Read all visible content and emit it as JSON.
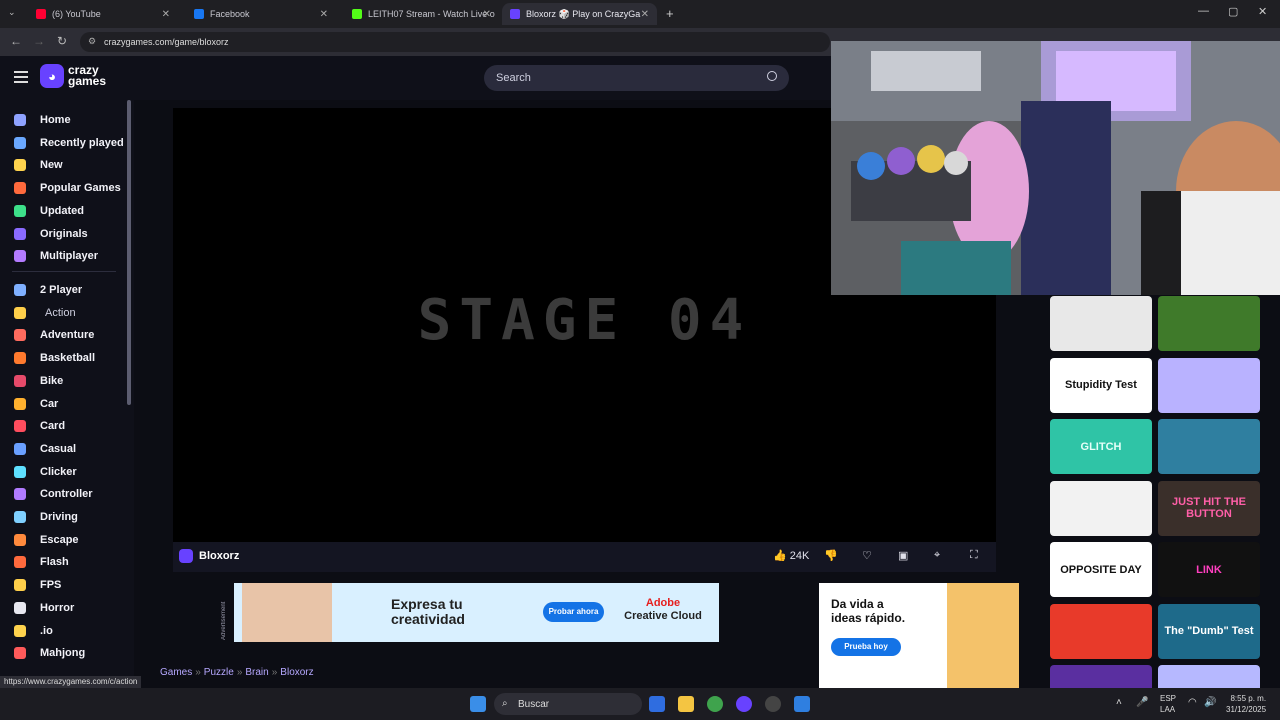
{
  "browser": {
    "tabs": [
      {
        "label": "(6) YouTube",
        "color": "#ff0033",
        "active": false
      },
      {
        "label": "Facebook",
        "color": "#1877f2",
        "active": false
      },
      {
        "label": "LEITH07 Stream - Watch Live o",
        "color": "#53fc18",
        "active": false
      },
      {
        "label": "Bloxorz 🎲 Play on CrazyGa",
        "color": "#6842ff",
        "active": true
      }
    ],
    "url": "crazygames.com/game/bloxorz",
    "status_url": "https://www.crazygames.com/c/action"
  },
  "site": {
    "logo_line1": "crazy",
    "logo_line2": "games",
    "search_placeholder": "Search"
  },
  "sidebar": {
    "top_items": [
      {
        "label": "Home",
        "icon": "home-icon",
        "color": "#8ea2ff"
      },
      {
        "label": "Recently played",
        "icon": "clock-icon",
        "color": "#6aa8ff"
      },
      {
        "label": "New",
        "icon": "sparkle-icon",
        "color": "#ffd34d"
      },
      {
        "label": "Popular Games",
        "icon": "fire-icon",
        "color": "#ff6a3d"
      },
      {
        "label": "Updated",
        "icon": "refresh-icon",
        "color": "#3de08a"
      },
      {
        "label": "Originals",
        "icon": "crazygames-icon",
        "color": "#8a6bff"
      },
      {
        "label": "Multiplayer",
        "icon": "players-icon",
        "color": "#b47bff"
      }
    ],
    "categories": [
      {
        "label": "2 Player",
        "icon": "two-player-icon",
        "color": "#7fb0ff"
      },
      {
        "label": "Action",
        "icon": "sword-icon",
        "color": "#ffcf4a"
      },
      {
        "label": "Adventure",
        "icon": "compass-icon",
        "color": "#ff6b5e"
      },
      {
        "label": "Basketball",
        "icon": "basketball-icon",
        "color": "#ff7a2e"
      },
      {
        "label": "Bike",
        "icon": "bike-icon",
        "color": "#e64a6a"
      },
      {
        "label": "Car",
        "icon": "car-icon",
        "color": "#ffb02e"
      },
      {
        "label": "Card",
        "icon": "card-icon",
        "color": "#ff4d5e"
      },
      {
        "label": "Casual",
        "icon": "casual-icon",
        "color": "#6aa0ff"
      },
      {
        "label": "Clicker",
        "icon": "cursor-icon",
        "color": "#5ee0ff"
      },
      {
        "label": "Controller",
        "icon": "gamepad-icon",
        "color": "#b07bff"
      },
      {
        "label": "Driving",
        "icon": "steering-icon",
        "color": "#7fd0ff"
      },
      {
        "label": "Escape",
        "icon": "door-icon",
        "color": "#ff8a3d"
      },
      {
        "label": "Flash",
        "icon": "flash-icon",
        "color": "#ff6a3d"
      },
      {
        "label": "FPS",
        "icon": "gun-icon",
        "color": "#ffcf4a"
      },
      {
        "label": "Horror",
        "icon": "ghost-icon",
        "color": "#e8e8f0"
      },
      {
        "label": ".io",
        "icon": "io-icon",
        "color": "#ffd34d"
      },
      {
        "label": "Mahjong",
        "icon": "mahjong-icon",
        "color": "#ff5a5a"
      }
    ]
  },
  "game": {
    "stage_text": "STAGE 04",
    "name": "Bloxorz",
    "likes": "24K"
  },
  "ads": {
    "ad1_label": "Advertisement",
    "ad1_headline_1": "Expresa tu",
    "ad1_headline_2": "creatividad",
    "ad1_cta": "Probar ahora",
    "ad1_brand_1": "Adobe",
    "ad1_brand_2": "Creative Cloud",
    "ad2_headline_1": "Da vida a",
    "ad2_headline_2": "ideas rápido.",
    "ad2_cta": "Prueba hoy"
  },
  "breadcrumb": [
    "Games",
    "Puzzle",
    "Brain",
    "Bloxorz"
  ],
  "thumbnails": [
    {
      "label": "",
      "bg": "#e8e8e8",
      "fg": "#111"
    },
    {
      "label": "",
      "bg": "#3f7a2a",
      "fg": "#fff"
    },
    {
      "label": "Stupidity Test",
      "bg": "#ffffff",
      "fg": "#111"
    },
    {
      "label": "",
      "bg": "#b9b2ff",
      "fg": "#fff"
    },
    {
      "label": "GLITCH",
      "bg": "#2fc4a6",
      "fg": "#e6fff8"
    },
    {
      "label": "",
      "bg": "#2f7fa0",
      "fg": "#fff"
    },
    {
      "label": "",
      "bg": "#f2f2f2",
      "fg": "#111"
    },
    {
      "label": "JUST HIT THE BUTTON",
      "bg": "#3a2f2a",
      "fg": "#ff5fa8"
    },
    {
      "label": "OPPOSITE DAY",
      "bg": "#ffffff",
      "fg": "#111"
    },
    {
      "label": "LINK",
      "bg": "#111111",
      "fg": "#ff3fbf"
    },
    {
      "label": "",
      "bg": "#e83a2a",
      "fg": "#fff"
    },
    {
      "label": "The \"Dumb\" Test",
      "bg": "#1e6a8a",
      "fg": "#ffffff"
    },
    {
      "label": "",
      "bg": "#5a2fa0",
      "fg": "#fff"
    },
    {
      "label": "",
      "bg": "#b6b8ff",
      "fg": "#fff"
    }
  ],
  "taskbar": {
    "search_label": "Buscar",
    "lang_1": "ESP",
    "lang_2": "LAA",
    "time": "8:55 p. m.",
    "date": "31/12/2025"
  }
}
